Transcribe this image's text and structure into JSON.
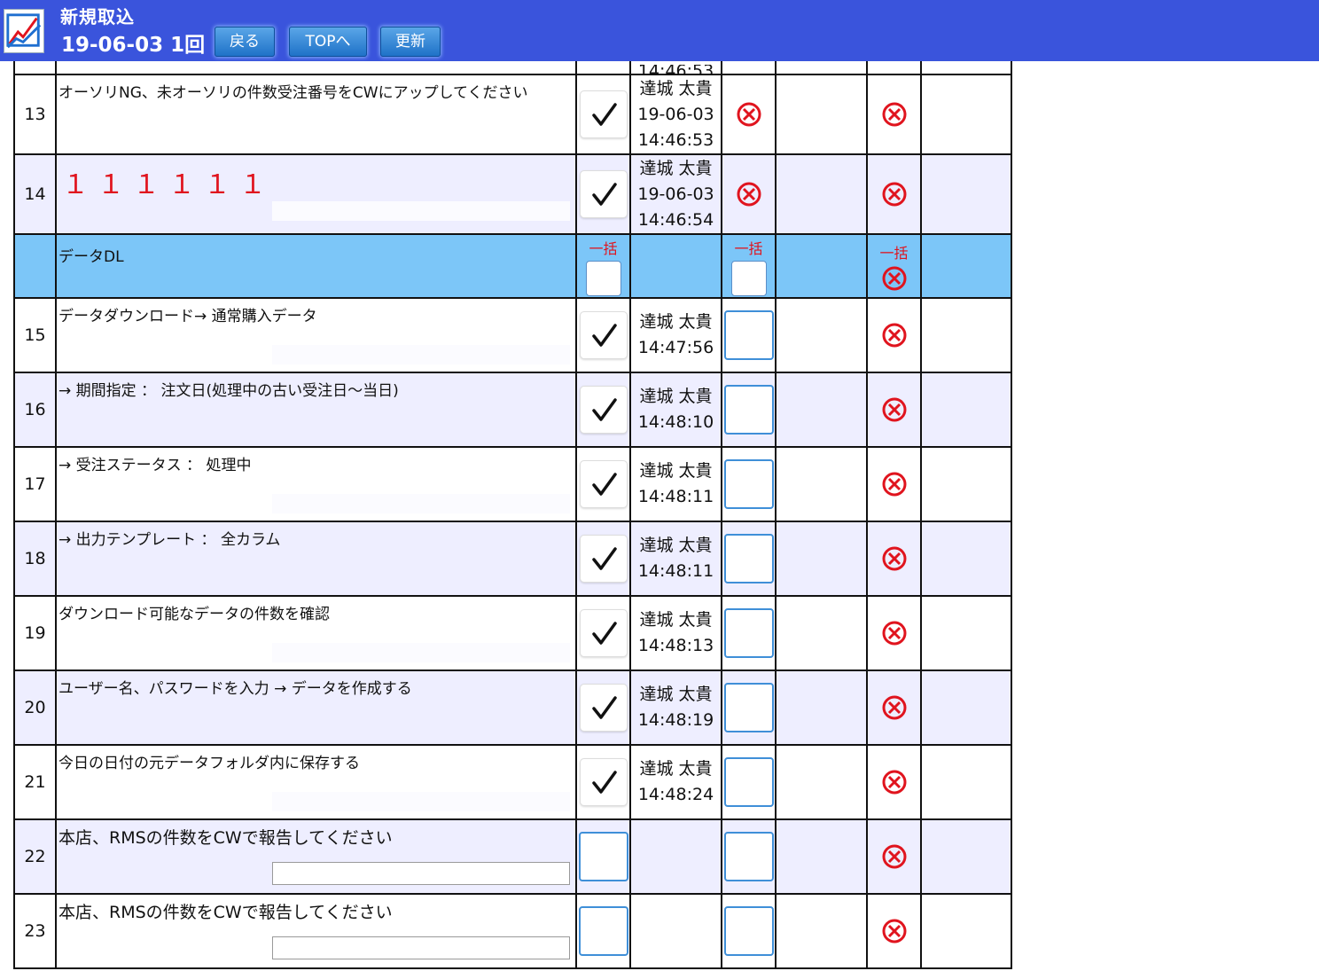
{
  "header": {
    "title": "新規取込",
    "session": "19-06-03 1回",
    "buttons": {
      "back": "戻る",
      "top": "TOPへ",
      "refresh": "更新"
    }
  },
  "colors": {
    "header_bg": "#3a54dc",
    "row_alt": "#eeeeff",
    "section_bg": "#7cc6f8",
    "danger": "#e0141e",
    "box_border": "#3f8fd8"
  },
  "partial_top_row": {
    "time_fragment": "14:46:53"
  },
  "section": {
    "title": "データDL",
    "bulk_label": "一括"
  },
  "rows": [
    {
      "num": "13",
      "text": "オーソリNG、未オーソリの件数受注番号をCWにアップしてください",
      "style": "",
      "checked": true,
      "user": "達城 太貴",
      "date": "19-06-03",
      "time": "14:46:53",
      "col4": "x",
      "note": "hidden"
    },
    {
      "num": "14",
      "text": "１１１１１１",
      "style": "red",
      "checked": true,
      "user": "達城 太貴",
      "date": "19-06-03",
      "time": "14:46:54",
      "col4": "x",
      "note": "faint"
    },
    {
      "num": "15",
      "text": "データダウンロード→ 通常購入データ",
      "style": "",
      "checked": true,
      "user": "達城 太貴",
      "date": "",
      "time": "14:47:56",
      "col4": "box",
      "note": "faint"
    },
    {
      "num": "16",
      "text": "→ 期間指定 ： 注文日(処理中の古い受注日〜当日)",
      "style": "",
      "checked": true,
      "user": "達城 太貴",
      "date": "",
      "time": "14:48:10",
      "col4": "box",
      "note": "hidden"
    },
    {
      "num": "17",
      "text": "→ 受注ステータス ： 処理中",
      "style": "",
      "checked": true,
      "user": "達城 太貴",
      "date": "",
      "time": "14:48:11",
      "col4": "box",
      "note": "faint"
    },
    {
      "num": "18",
      "text": "→ 出力テンプレート ： 全カラム",
      "style": "",
      "checked": true,
      "user": "達城 太貴",
      "date": "",
      "time": "14:48:11",
      "col4": "box",
      "note": "hidden"
    },
    {
      "num": "19",
      "text": "ダウンロード可能なデータの件数を確認",
      "style": "",
      "checked": true,
      "user": "達城 太貴",
      "date": "",
      "time": "14:48:13",
      "col4": "box",
      "note": "faint"
    },
    {
      "num": "20",
      "text": "ユーザー名、パスワードを入力 → データを作成する",
      "style": "",
      "checked": true,
      "user": "達城 太貴",
      "date": "",
      "time": "14:48:19",
      "col4": "box",
      "note": "hidden"
    },
    {
      "num": "21",
      "text": "今日の日付の元データフォルダ内に保存する",
      "style": "",
      "checked": true,
      "user": "達城 太貴",
      "date": "",
      "time": "14:48:24",
      "col4": "box",
      "note": "faint"
    },
    {
      "num": "22",
      "text": "本店、RMSの件数をCWで報告してください",
      "style": "big",
      "checked": false,
      "user": "",
      "date": "",
      "time": "",
      "col4": "box",
      "note": "visible"
    },
    {
      "num": "23",
      "text": "本店、RMSの件数をCWで報告してください",
      "style": "big",
      "checked": false,
      "user": "",
      "date": "",
      "time": "",
      "col4": "box",
      "note": "visible"
    }
  ]
}
